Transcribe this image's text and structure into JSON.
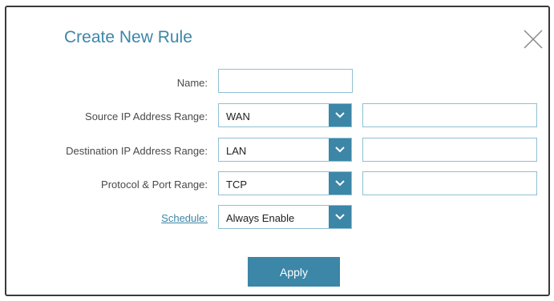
{
  "dialog": {
    "title": "Create New Rule",
    "close_icon": "close-icon"
  },
  "form": {
    "name": {
      "label": "Name:",
      "value": ""
    },
    "source_ip": {
      "label": "Source IP Address Range:",
      "selected": "WAN",
      "value": ""
    },
    "destination_ip": {
      "label": "Destination IP Address Range:",
      "selected": "LAN",
      "value": ""
    },
    "protocol_port": {
      "label": "Protocol & Port Range:",
      "selected": "TCP",
      "value": ""
    },
    "schedule": {
      "label": "Schedule:",
      "selected": "Always Enable"
    }
  },
  "actions": {
    "apply_label": "Apply"
  },
  "colors": {
    "accent": "#3c86a7",
    "border": "#8fbfd3",
    "label": "#4a4a4a"
  }
}
